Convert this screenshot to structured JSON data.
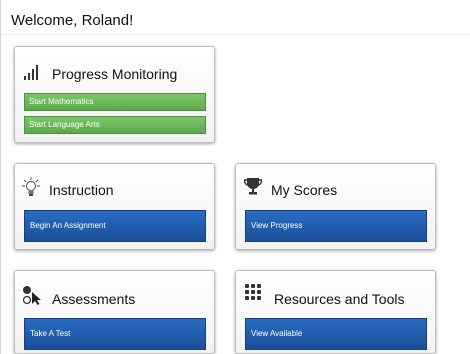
{
  "header": {
    "welcome": "Welcome, Roland!"
  },
  "progress_monitoring": {
    "title": "Progress Monitoring",
    "icon": "signal-bars-icon",
    "buttons": [
      "Start Mathematics",
      "Start Language Arts"
    ],
    "button_color": "#6bb85a"
  },
  "instruction": {
    "title": "Instruction",
    "icon": "lightbulb-icon",
    "button": "Begin An Assignment"
  },
  "my_scores": {
    "title": "My Scores",
    "icon": "trophy-icon",
    "button": "View Progress"
  },
  "assessments": {
    "title": "Assessments",
    "icon": "cursor-click-icon",
    "button": "Take A Test"
  },
  "resources": {
    "title": "Resources and Tools",
    "icon": "grid-dots-icon",
    "button": "View Available"
  },
  "accent_blue": "#1f5aad"
}
